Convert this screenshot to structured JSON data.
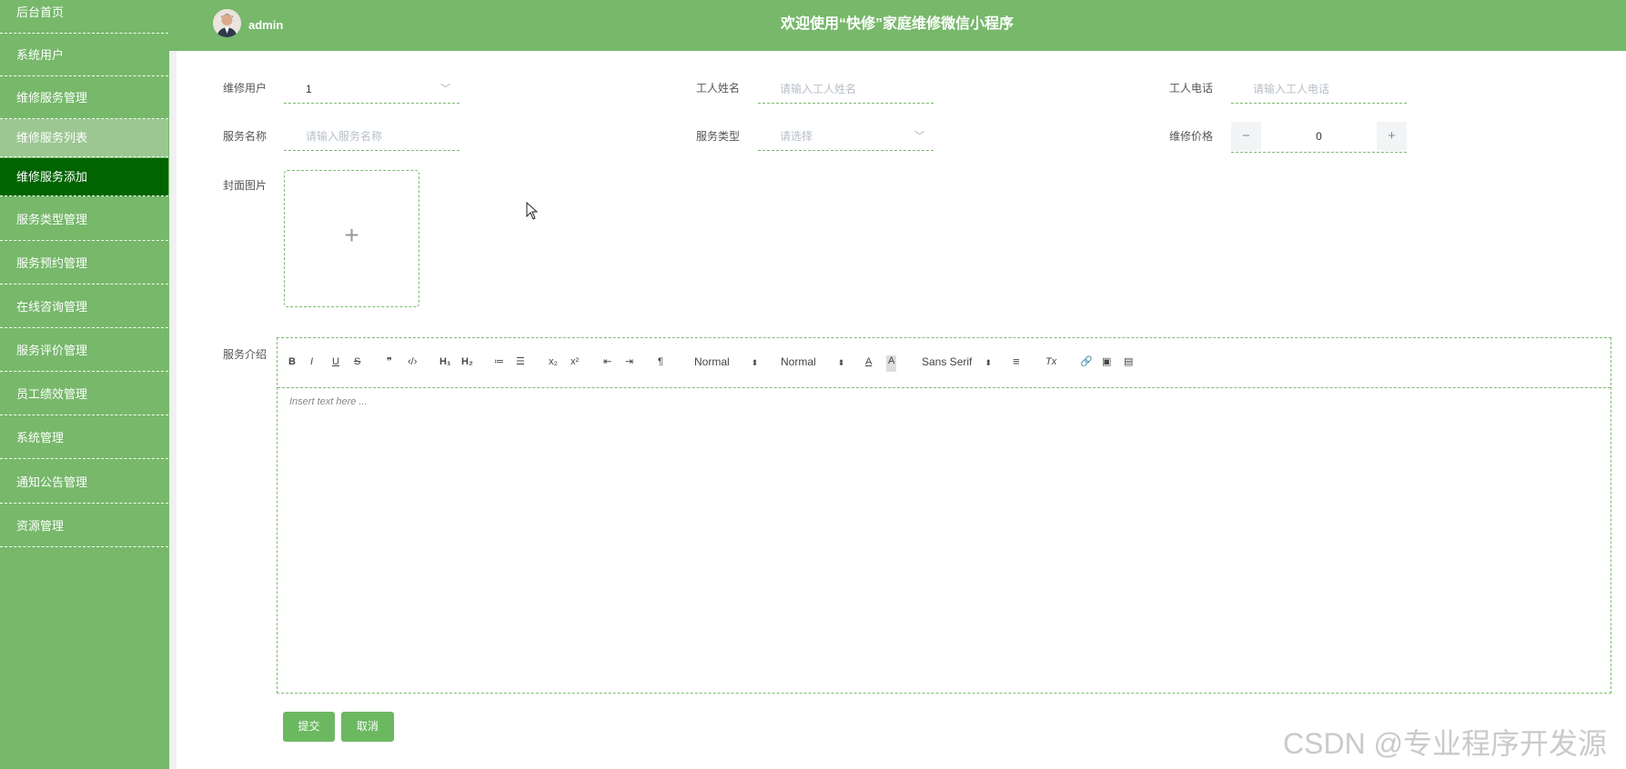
{
  "header": {
    "username": "admin",
    "title": "欢迎使用“快修”家庭维修微信小程序"
  },
  "sidebar": {
    "items": [
      {
        "label": "后台首页"
      },
      {
        "label": "系统用户"
      },
      {
        "label": "维修服务管理"
      },
      {
        "label": "维修服务列表"
      },
      {
        "label": "维修服务添加"
      },
      {
        "label": "服务类型管理"
      },
      {
        "label": "服务预约管理"
      },
      {
        "label": "在线咨询管理"
      },
      {
        "label": "服务评价管理"
      },
      {
        "label": "员工绩效管理"
      },
      {
        "label": "系统管理"
      },
      {
        "label": "通知公告管理"
      },
      {
        "label": "资源管理"
      }
    ],
    "active": "维修服务添加"
  },
  "form": {
    "repair_user": {
      "label": "维修用户",
      "value": "1"
    },
    "worker_name": {
      "label": "工人姓名",
      "placeholder": "请输入工人姓名"
    },
    "worker_phone": {
      "label": "工人电话",
      "placeholder": "请输入工人电话"
    },
    "service_name": {
      "label": "服务名称",
      "placeholder": "请输入服务名称"
    },
    "service_type": {
      "label": "服务类型",
      "placeholder": "请选择"
    },
    "price": {
      "label": "维修价格",
      "value": "0",
      "minus": "−",
      "plus": "+"
    },
    "cover": {
      "label": "封面图片",
      "plus": "+"
    },
    "intro": {
      "label": "服务介绍",
      "placeholder": "Insert text here ...",
      "toolbar": {
        "bold": "B",
        "italic": "I",
        "underline": "U",
        "strike": "S",
        "quote": "❞",
        "code": "‹/›",
        "h1": "H₁",
        "h2": "H₂",
        "ordered_list": "≔",
        "bullet_list": "☰",
        "sub": "x₂",
        "sup": "x²",
        "outdent": "⇤",
        "indent": "⇥",
        "direction": "¶",
        "size_select": "Normal",
        "header_select": "Normal",
        "color": "A",
        "background": "A",
        "font_select": "Sans Serif",
        "align": "≡",
        "clean": "Tx",
        "link": "🔗",
        "image": "▣",
        "video": "▤"
      }
    }
  },
  "actions": {
    "submit": "提交",
    "cancel": "取消"
  },
  "watermark": "CSDN @专业程序开发源",
  "colors": {
    "sidebar": "#77b86b",
    "active": "#006400",
    "accent": "#6cb861"
  }
}
